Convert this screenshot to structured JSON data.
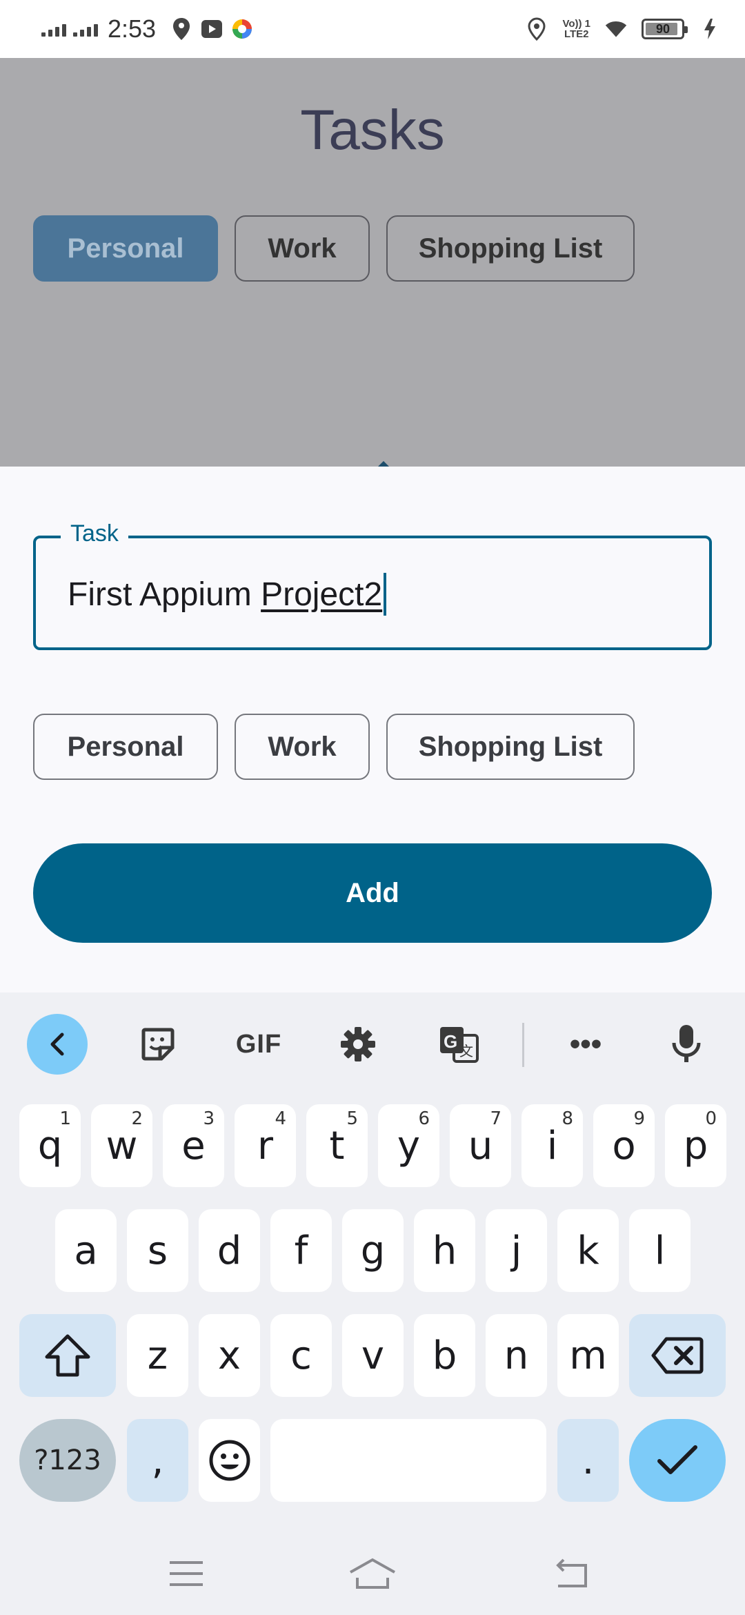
{
  "status_bar": {
    "time": "2:53",
    "network_label": "Vo) 1\nLTE2",
    "battery": "90"
  },
  "app": {
    "title": "Tasks",
    "categories": [
      "Personal",
      "Work",
      "Shopping List"
    ],
    "selected_category": "Personal"
  },
  "sheet": {
    "task_label": "Task",
    "task_value_plain": "First Appium ",
    "task_value_composing": "Project2",
    "categories": [
      "Personal",
      "Work",
      "Shopping List"
    ],
    "add_label": "Add"
  },
  "keyboard": {
    "toolbar": {
      "gif_label": "GIF",
      "more_label": "•••"
    },
    "row1": [
      {
        "key": "q",
        "hint": "1"
      },
      {
        "key": "w",
        "hint": "2"
      },
      {
        "key": "e",
        "hint": "3"
      },
      {
        "key": "r",
        "hint": "4"
      },
      {
        "key": "t",
        "hint": "5"
      },
      {
        "key": "y",
        "hint": "6"
      },
      {
        "key": "u",
        "hint": "7"
      },
      {
        "key": "i",
        "hint": "8"
      },
      {
        "key": "o",
        "hint": "9"
      },
      {
        "key": "p",
        "hint": "0"
      }
    ],
    "row2": [
      "a",
      "s",
      "d",
      "f",
      "g",
      "h",
      "j",
      "k",
      "l"
    ],
    "row3": [
      "z",
      "x",
      "c",
      "v",
      "b",
      "n",
      "m"
    ],
    "row4": {
      "symbols_label": "?123",
      "comma": ",",
      "period": "."
    }
  },
  "colors": {
    "primary": "#006389",
    "selected_chip_dimmed": "#4b7598",
    "scrim": "#aaaaad",
    "keyboard_bg": "#eff0f4",
    "accent_key": "#7dcbf8",
    "modifier_key": "#d4e5f4"
  },
  "icons": [
    "signal-icon",
    "location-icon",
    "youtube-icon",
    "assistant-icon",
    "wifi-icon",
    "charging-icon",
    "sticker-icon",
    "settings-icon",
    "translate-icon",
    "mic-icon",
    "shift-icon",
    "backspace-icon",
    "emoji-icon",
    "check-icon",
    "menu-icon",
    "home-icon",
    "back-icon"
  ]
}
